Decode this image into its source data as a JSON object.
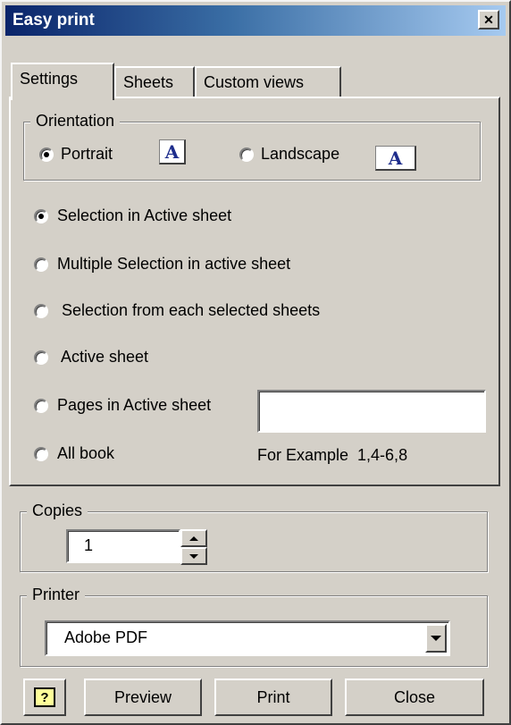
{
  "window": {
    "title": "Easy print",
    "close_glyph": "✕"
  },
  "tabs": [
    {
      "label": "Settings",
      "active": true
    },
    {
      "label": "Sheets",
      "active": false
    },
    {
      "label": "Custom views",
      "active": false
    }
  ],
  "orientation": {
    "legend": "Orientation",
    "portrait": {
      "label": "Portrait",
      "checked": true,
      "icon_glyph": "A"
    },
    "landscape": {
      "label": "Landscape",
      "checked": false,
      "icon_glyph": "A"
    }
  },
  "selection_options": [
    {
      "label": "Selection in Active sheet",
      "checked": true
    },
    {
      "label": "Multiple Selection in active sheet",
      "checked": false
    },
    {
      "label": " Selection from each selected sheets",
      "checked": false
    },
    {
      "label": " Active sheet",
      "checked": false
    },
    {
      "label": "Pages in Active sheet",
      "checked": false
    },
    {
      "label": "All book",
      "checked": false
    }
  ],
  "pages_input": {
    "value": ""
  },
  "example_text": "For Example  1,4-6,8",
  "copies": {
    "legend": "Copies",
    "value": "1"
  },
  "printer": {
    "legend": "Printer",
    "selected": "Adobe PDF"
  },
  "buttons": {
    "help_glyph": "?",
    "preview": "Preview",
    "print": "Print",
    "close": "Close"
  },
  "colors": {
    "face": "#d4d0c8",
    "title_start": "#0a246a",
    "title_end": "#a6caf0",
    "icon_blue": "#1e2d8c"
  }
}
